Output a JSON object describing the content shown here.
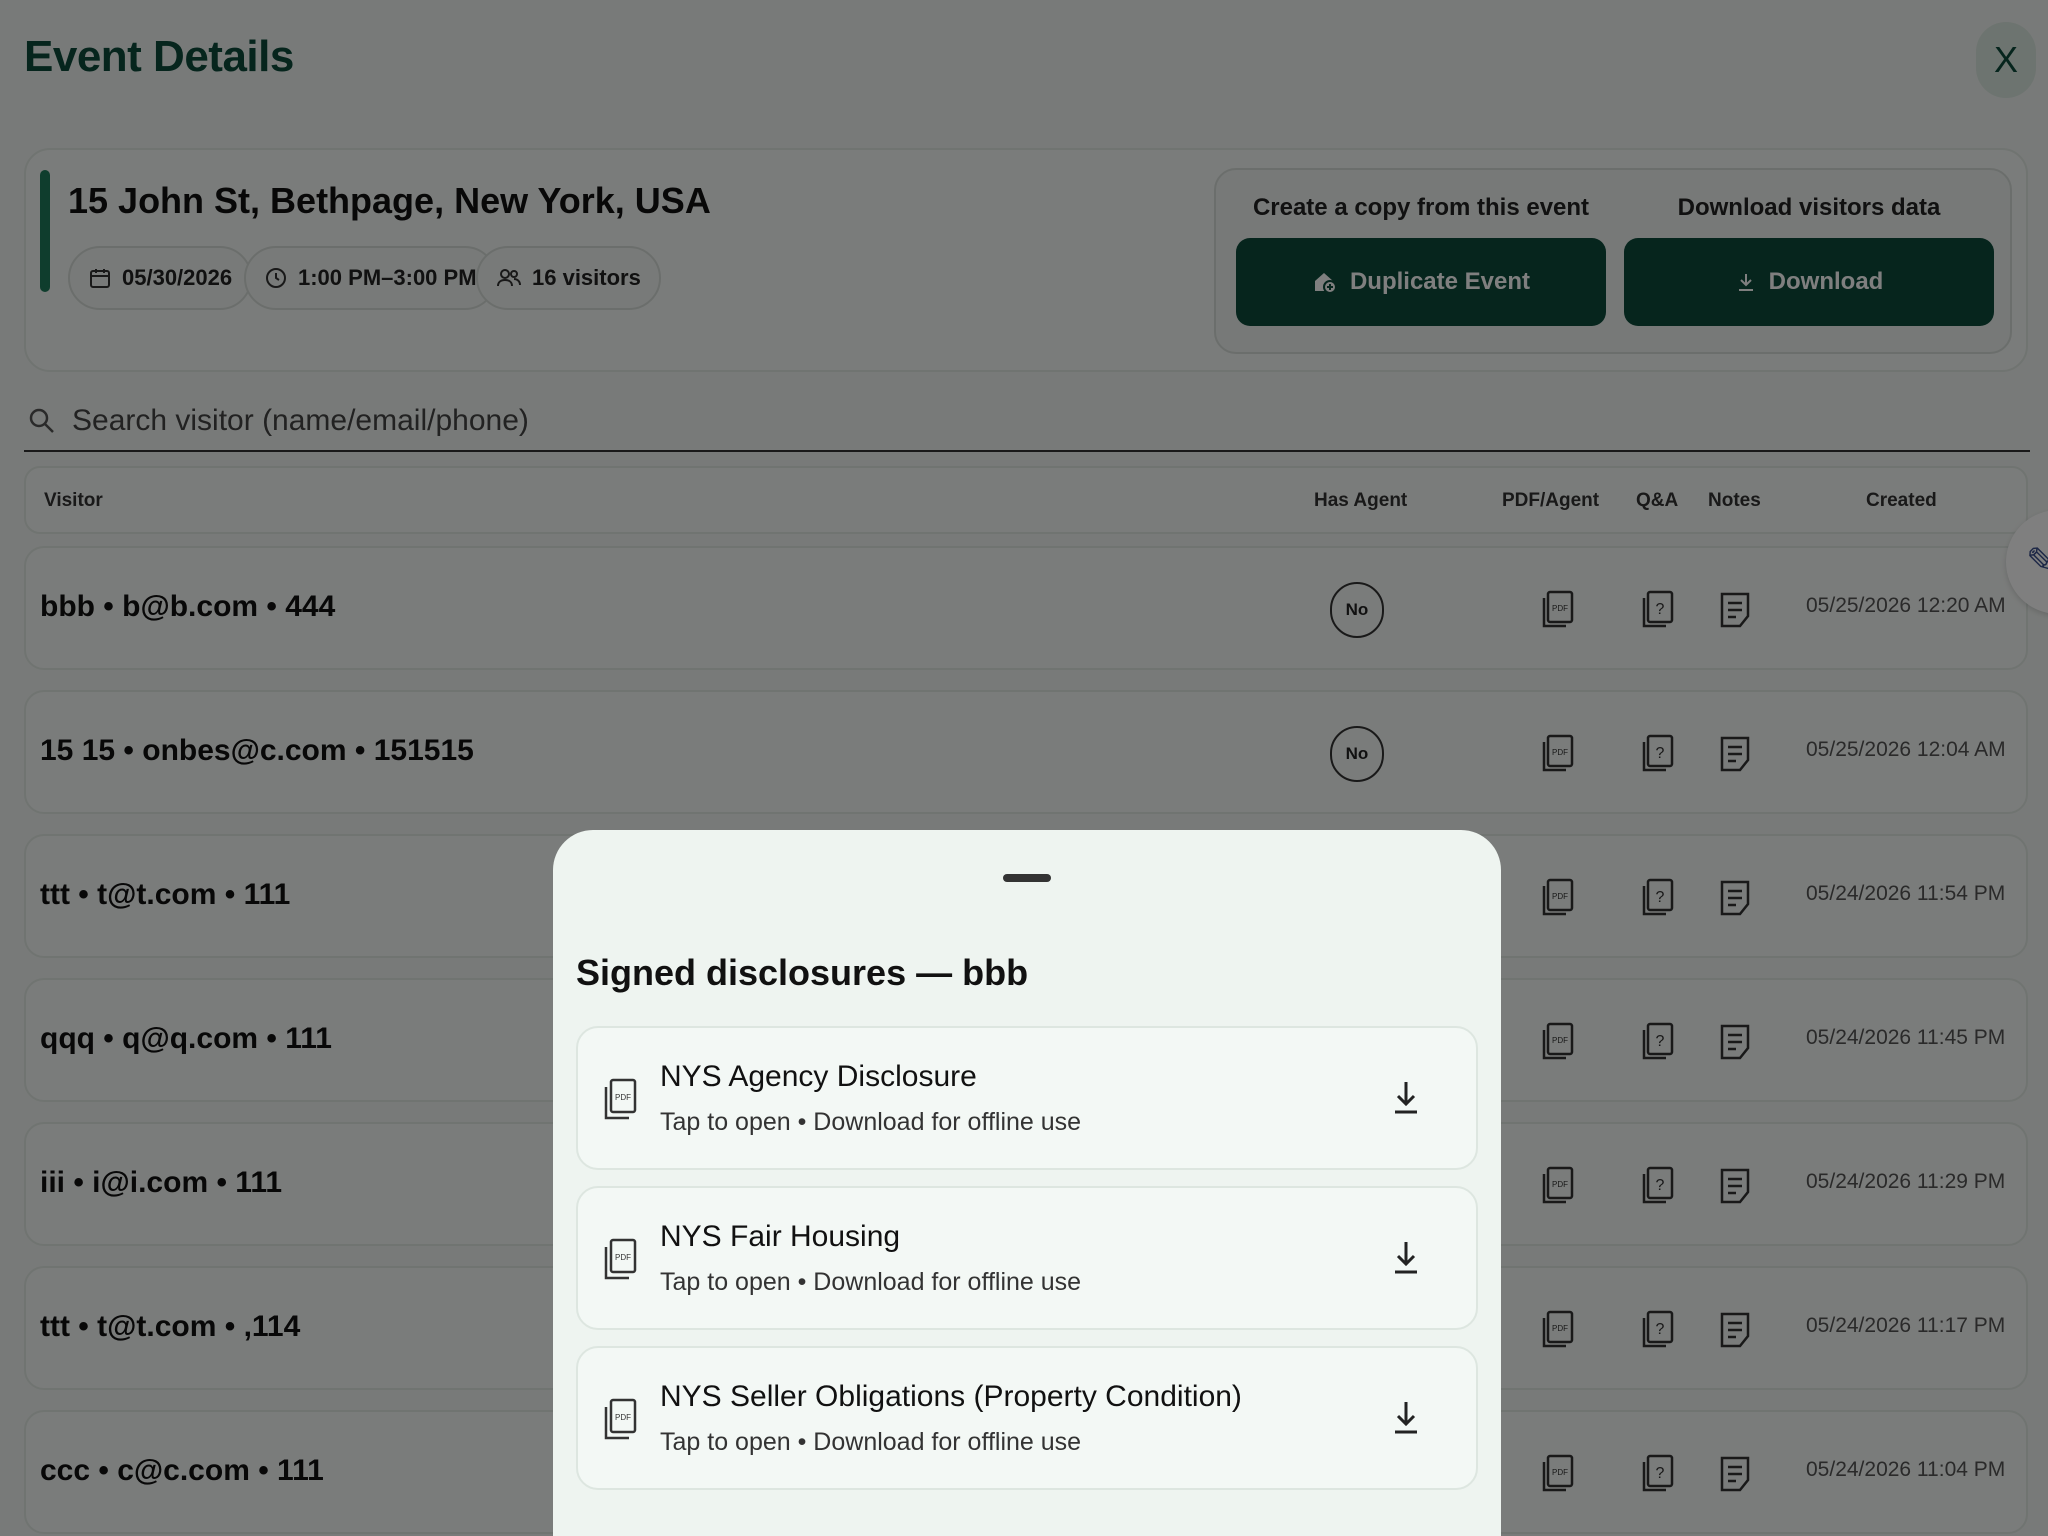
{
  "header": {
    "title": "Event Details",
    "close_label": "X"
  },
  "event": {
    "address": "15 John St, Bethpage, New York, USA",
    "date": "05/30/2026",
    "time": "1:00 PM–3:00 PM",
    "visitors": "16 visitors",
    "copy_label": "Create a copy from this event",
    "duplicate_button": "Duplicate Event",
    "download_label": "Download visitors data",
    "download_button": "Download"
  },
  "search": {
    "placeholder": "Search visitor (name/email/phone)"
  },
  "table": {
    "columns": {
      "visitor": "Visitor",
      "has_agent": "Has Agent",
      "pdf_agent": "PDF/Agent",
      "qa": "Q&A",
      "notes": "Notes",
      "created": "Created"
    },
    "rows": [
      {
        "visitor": "bbb • b@b.com • 444",
        "has_agent": "No",
        "created": "05/25/2026 12:20 AM"
      },
      {
        "visitor": "15 15 • onbes@c.com • 151515",
        "has_agent": "No",
        "created": "05/25/2026 12:04 AM"
      },
      {
        "visitor": "ttt • t@t.com • 111",
        "created": "05/24/2026 11:54 PM"
      },
      {
        "visitor": "qqq • q@q.com • 111",
        "created": "05/24/2026 11:45 PM"
      },
      {
        "visitor": "iii • i@i.com • 111",
        "created": "05/24/2026 11:29 PM"
      },
      {
        "visitor": "ttt • t@t.com • ,114",
        "created": "05/24/2026 11:17 PM"
      },
      {
        "visitor": "ccc • c@c.com • 111",
        "created": "05/24/2026 11:04 PM"
      }
    ]
  },
  "sheet": {
    "title": "Signed disclosures — bbb",
    "items": [
      {
        "name": "NYS Agency Disclosure",
        "subtitle": "Tap to open • Download for offline use"
      },
      {
        "name": "NYS Fair Housing",
        "subtitle": "Tap to open • Download for offline use"
      },
      {
        "name": "NYS Seller Obligations (Property Condition)",
        "subtitle": "Tap to open • Download for offline use"
      }
    ]
  },
  "icons": {
    "close": "close-icon",
    "calendar": "calendar-icon",
    "clock": "clock-icon",
    "people": "people-icon",
    "duplicate": "duplicate-home-icon",
    "download": "download-icon",
    "search": "search-icon",
    "pdf": "pdf-icon",
    "qa": "question-icon",
    "notes": "notes-icon",
    "edit": "pencil-icon"
  },
  "colors": {
    "brand": "#0c4a3a",
    "accent": "#1e7a5a",
    "background": "#f1f5f2",
    "sheet": "#eef4f0"
  }
}
